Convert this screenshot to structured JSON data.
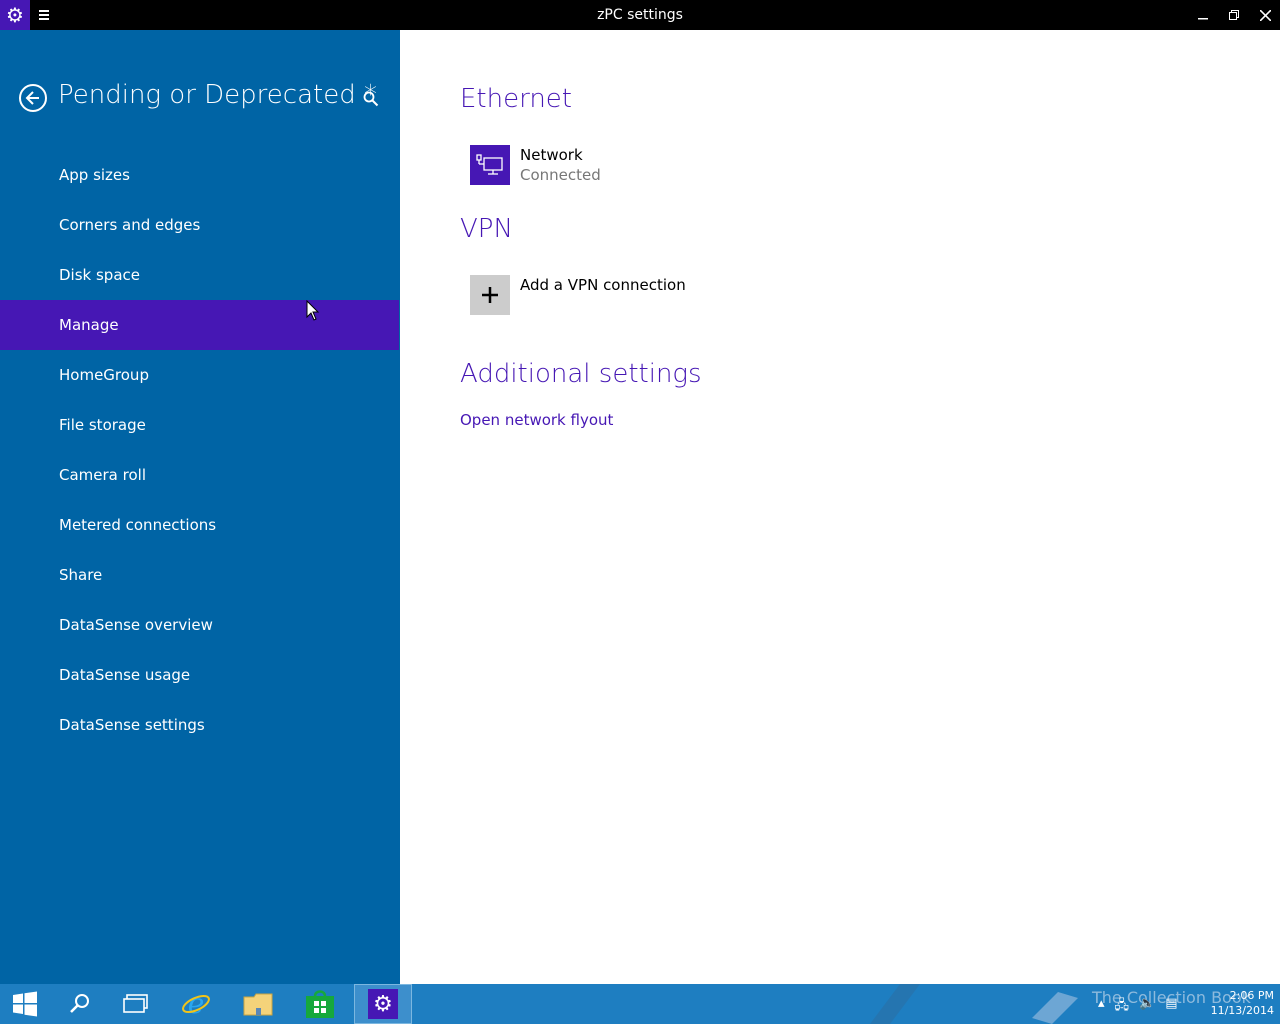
{
  "window": {
    "title": "zPC settings",
    "app_icon": "gear-icon",
    "menu_icon": "hamburger-icon",
    "controls": [
      "minimize-icon",
      "restore-icon",
      "close-icon"
    ]
  },
  "sidebar": {
    "title": "Pending or Deprecated *",
    "back_icon": "back-arrow-icon",
    "search_icon": "search-icon",
    "items": [
      {
        "label": "App sizes"
      },
      {
        "label": "Corners and edges"
      },
      {
        "label": "Disk space"
      },
      {
        "label": "Manage",
        "selected": true
      },
      {
        "label": "HomeGroup"
      },
      {
        "label": "File storage"
      },
      {
        "label": "Camera roll"
      },
      {
        "label": "Metered connections"
      },
      {
        "label": "Share"
      },
      {
        "label": "DataSense overview"
      },
      {
        "label": "DataSense usage"
      },
      {
        "label": "DataSense settings"
      }
    ]
  },
  "main": {
    "ethernet": {
      "heading": "Ethernet",
      "network_name": "Network",
      "network_status": "Connected",
      "icon": "ethernet-icon"
    },
    "vpn": {
      "heading": "VPN",
      "add_label": "Add a VPN connection",
      "icon": "plus-icon"
    },
    "additional": {
      "heading": "Additional settings",
      "link": "Open network flyout"
    }
  },
  "taskbar": {
    "items": [
      "start-icon",
      "search-icon",
      "task-view-icon",
      "internet-explorer-icon",
      "file-explorer-icon",
      "store-icon",
      "settings-icon"
    ],
    "active": "settings-icon",
    "watermark": "The Collection Book",
    "clock_time": "2:06 PM",
    "clock_date": "11/13/2014"
  },
  "colors": {
    "sidebar_bg": "#0064a5",
    "accent": "#4617b4",
    "titlebar_bg": "#000000",
    "taskbar_bg": "#1e7ec1"
  }
}
